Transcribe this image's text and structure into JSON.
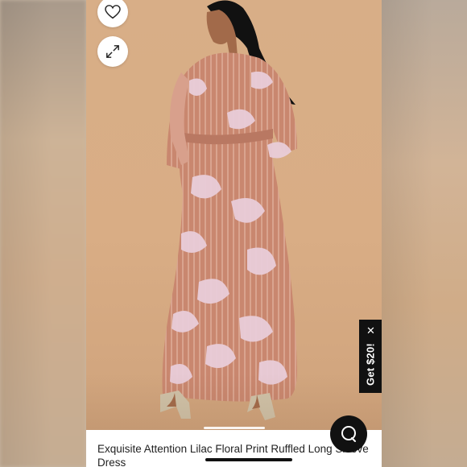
{
  "product": {
    "name": "Exquisite Attention Lilac Floral Print Ruffled Long Sleeve Dress"
  },
  "promo": {
    "label": "Get $20!",
    "close_icon": "close-icon"
  },
  "icons": {
    "favorite": "heart-icon",
    "expand": "expand-icon",
    "chat": "chat-icon"
  },
  "colors": {
    "background": "#d7ab84",
    "dress_base": "#c98a72",
    "dress_print": "#e6c9d6",
    "promo_bg": "#111111"
  }
}
